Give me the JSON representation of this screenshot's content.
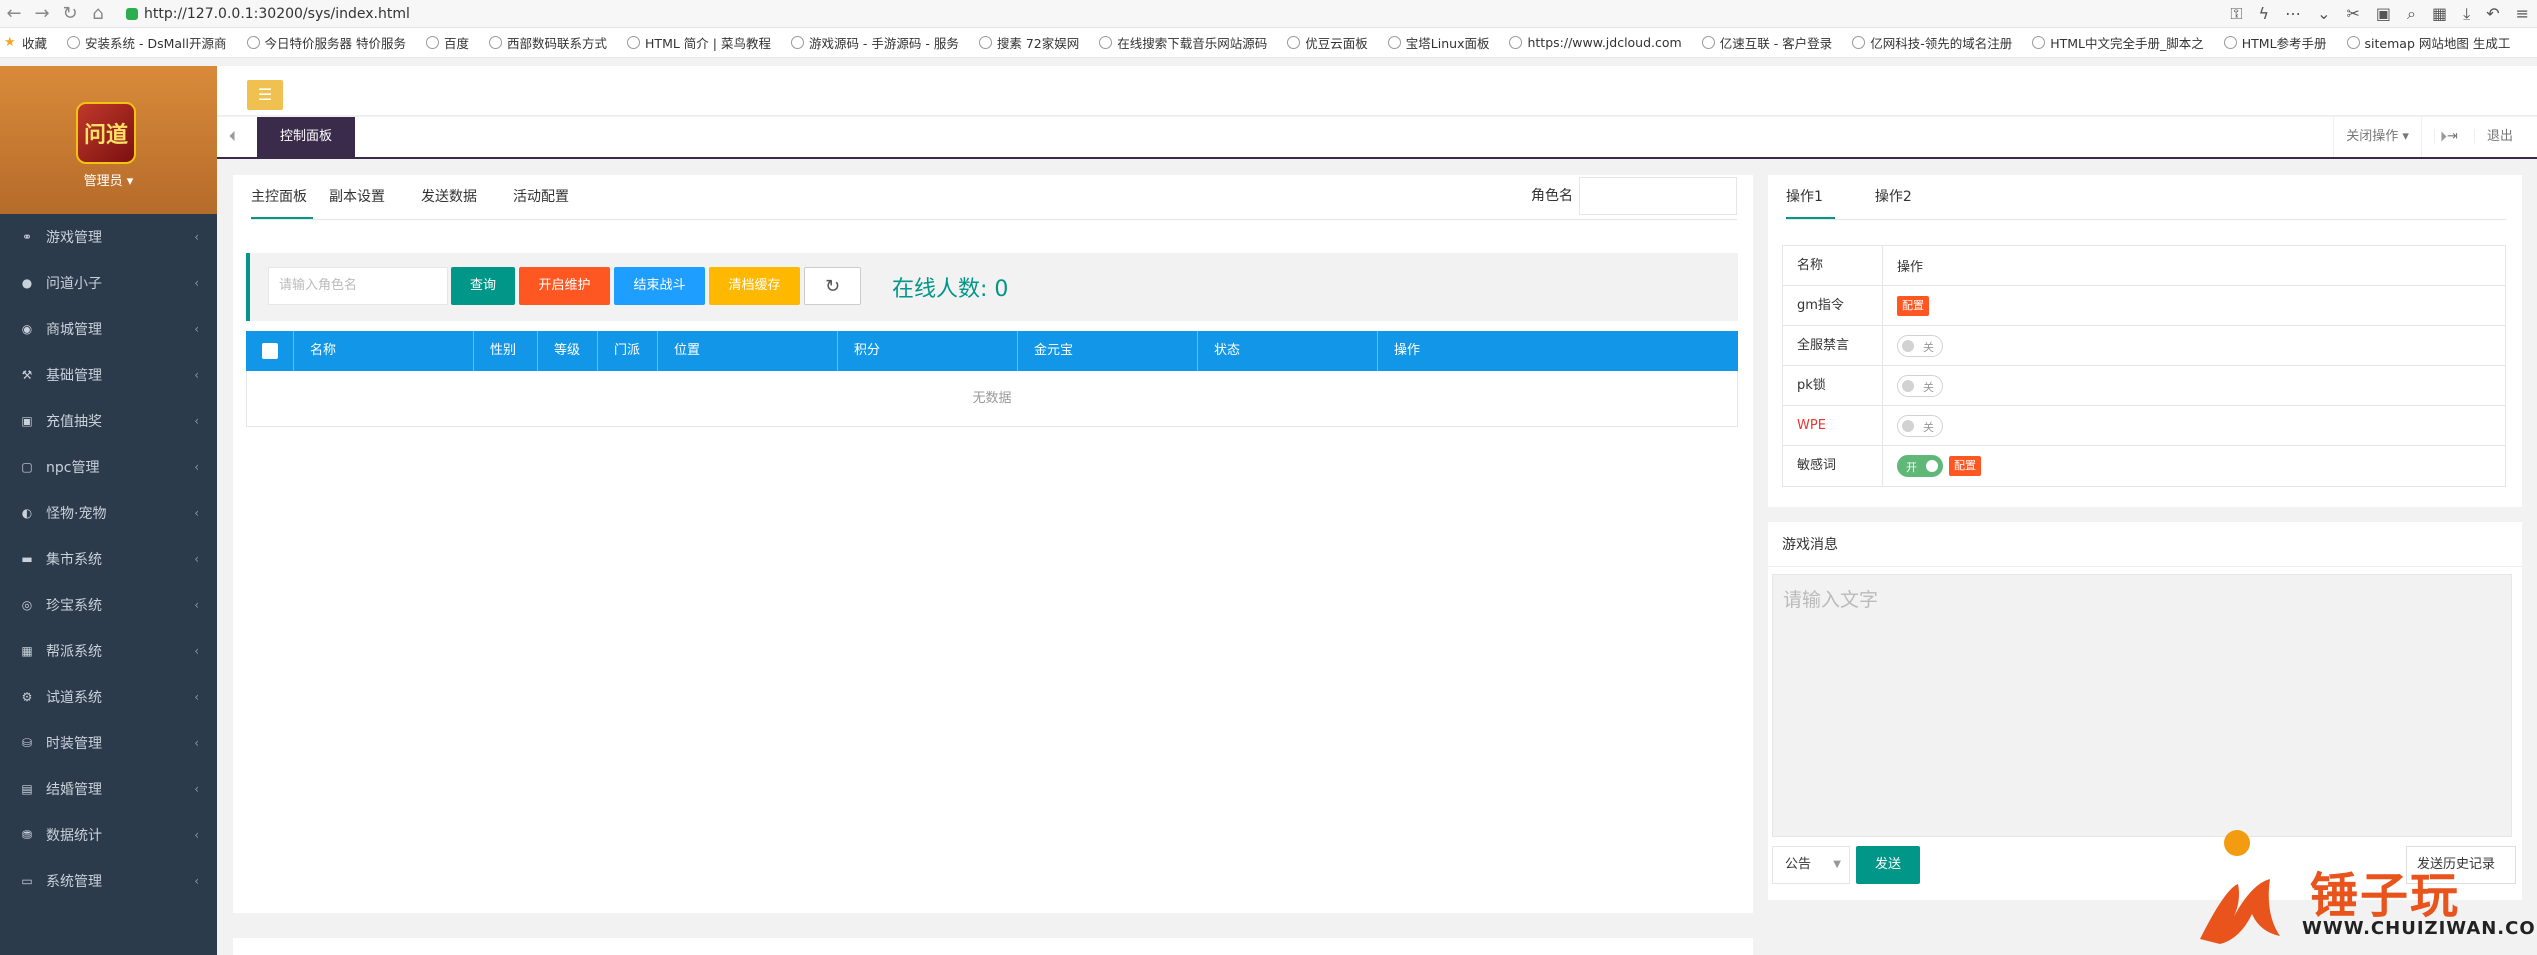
{
  "browser": {
    "url": "http://127.0.0.1:30200/sys/index.html",
    "bookmarks": [
      {
        "label": "收藏",
        "icon": "star-icon"
      },
      {
        "label": "安装系统 - DsMall开源商",
        "icon": "globe-icon"
      },
      {
        "label": "今日特价服务器 特价服务",
        "icon": "cloud-icon"
      },
      {
        "label": "百度",
        "icon": "baidu-icon"
      },
      {
        "label": "西部数码联系方式",
        "icon": "globe-icon"
      },
      {
        "label": "HTML 简介 | 菜鸟教程",
        "icon": "runoob-icon"
      },
      {
        "label": "游戏源码 - 手游源码 - 服务",
        "icon": "tree-icon"
      },
      {
        "label": "搜素 72家娱网",
        "icon": "site-icon"
      },
      {
        "label": "在线搜索下载音乐网站源码",
        "icon": "globe-icon"
      },
      {
        "label": "优豆云面板",
        "icon": "bt-icon"
      },
      {
        "label": "宝塔Linux面板",
        "icon": "globe-icon"
      },
      {
        "label": "https://www.jdcloud.com",
        "icon": "globe-icon"
      },
      {
        "label": "亿速互联 - 客户登录",
        "icon": "yisu-icon"
      },
      {
        "label": "亿网科技-领先的域名注册",
        "icon": "globe-icon"
      },
      {
        "label": "HTML中文完全手册_脚本之",
        "icon": "script-icon"
      },
      {
        "label": "HTML参考手册",
        "icon": "plus-icon"
      },
      {
        "label": "sitemap 网站地图 生成工",
        "icon": "sitemap-icon"
      }
    ]
  },
  "sidebar": {
    "admin": "管理员 ▾",
    "logo_text": "问道",
    "items": [
      {
        "label": "游戏管理",
        "icon": "gamepad-icon",
        "glyph": "⚭"
      },
      {
        "label": "问道小子",
        "icon": "user-icon",
        "glyph": "●"
      },
      {
        "label": "商城管理",
        "icon": "shop-icon",
        "glyph": "◉"
      },
      {
        "label": "基础管理",
        "icon": "tools-icon",
        "glyph": "⚒"
      },
      {
        "label": "充值抽奖",
        "icon": "money-icon",
        "glyph": "▣"
      },
      {
        "label": "npc管理",
        "icon": "npc-icon",
        "glyph": "▢"
      },
      {
        "label": "怪物·宠物",
        "icon": "monster-icon",
        "glyph": "◐"
      },
      {
        "label": "集市系统",
        "icon": "market-icon",
        "glyph": "▬"
      },
      {
        "label": "珍宝系统",
        "icon": "treasure-icon",
        "glyph": "◎"
      },
      {
        "label": "帮派系统",
        "icon": "guild-icon",
        "glyph": "▦"
      },
      {
        "label": "试道系统",
        "icon": "cogs-icon",
        "glyph": "⚙"
      },
      {
        "label": "时装管理",
        "icon": "fashion-icon",
        "glyph": "⛁"
      },
      {
        "label": "结婚管理",
        "icon": "marriage-icon",
        "glyph": "▤"
      },
      {
        "label": "数据统计",
        "icon": "database-icon",
        "glyph": "⛃"
      },
      {
        "label": "系统管理",
        "icon": "monitor-icon",
        "glyph": "▭"
      }
    ]
  },
  "tabbar": {
    "home": "控制面板",
    "close_ops": "关闭操作 ▾",
    "logout": "退出"
  },
  "main": {
    "tabs": [
      "主控面板",
      "副本设置",
      "发送数据",
      "活动配置"
    ],
    "role_label": "角色名",
    "search_placeholder": "请输入角色名",
    "buttons": {
      "query": "查询",
      "maintenance": "开启维护",
      "end_battle": "结束战斗",
      "clear_cache": "清档缓存",
      "refresh": "↻"
    },
    "online_label": "在线人数: 0",
    "table": {
      "headers": [
        "名称",
        "性别",
        "等级",
        "门派",
        "位置",
        "积分",
        "金元宝",
        "状态",
        "操作"
      ],
      "empty": "无数据"
    }
  },
  "ops": {
    "tabs": [
      "操作1",
      "操作2"
    ],
    "header": {
      "name": "名称",
      "action": "操作"
    },
    "rows": [
      {
        "name": "gm指令",
        "config": "配置"
      },
      {
        "name": "全服禁言",
        "switch": "关"
      },
      {
        "name": "pk锁",
        "switch": "关"
      },
      {
        "name": "WPE",
        "switch": "关",
        "name_color": "#e53935"
      },
      {
        "name": "敏感词",
        "switch": "开",
        "config": "配置"
      }
    ]
  },
  "message": {
    "title": "游戏消息",
    "placeholder": "请输入文字",
    "type": "公告",
    "send": "发送",
    "history": "发送历史记录"
  },
  "watermark": {
    "brand": "锤子玩",
    "url": "WWW.CHUIZIWAN.COM"
  }
}
